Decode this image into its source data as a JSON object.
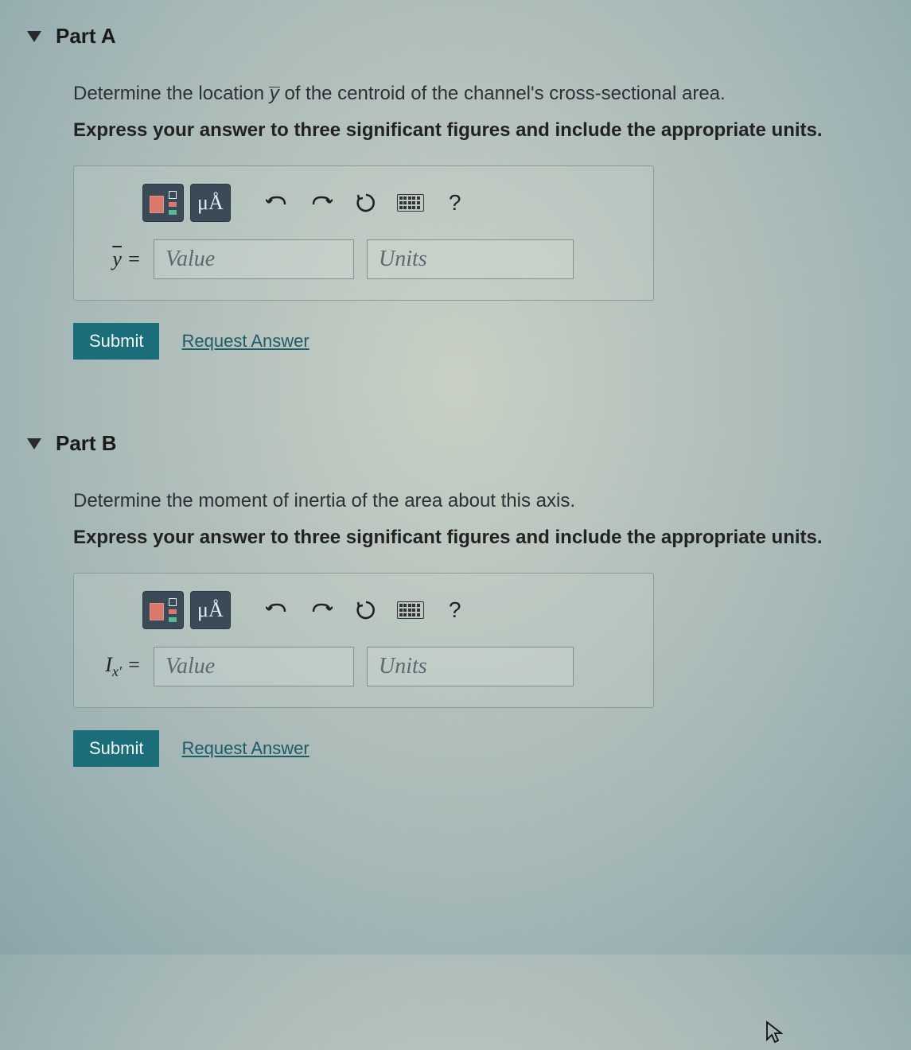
{
  "parts": [
    {
      "title": "Part A",
      "prompt_prefix": "Determine the location ",
      "prompt_var_html": "ȳ",
      "prompt_suffix": " of the centroid of the channel's cross-sectional area.",
      "hint": "Express your answer to three significant figures and include the appropriate units.",
      "variable_label": "ȳ =",
      "value_placeholder": "Value",
      "units_placeholder": "Units",
      "submit_label": "Submit",
      "request_label": "Request Answer",
      "toolbar": {
        "mu_label": "μÅ",
        "help_label": "?"
      }
    },
    {
      "title": "Part B",
      "prompt": "Determine the moment of inertia of the area about this axis.",
      "hint": "Express your answer to three significant figures and include the appropriate units.",
      "variable_label_html": "I_x' =",
      "value_placeholder": "Value",
      "units_placeholder": "Units",
      "submit_label": "Submit",
      "request_label": "Request Answer",
      "toolbar": {
        "mu_label": "μÅ",
        "help_label": "?"
      }
    }
  ]
}
